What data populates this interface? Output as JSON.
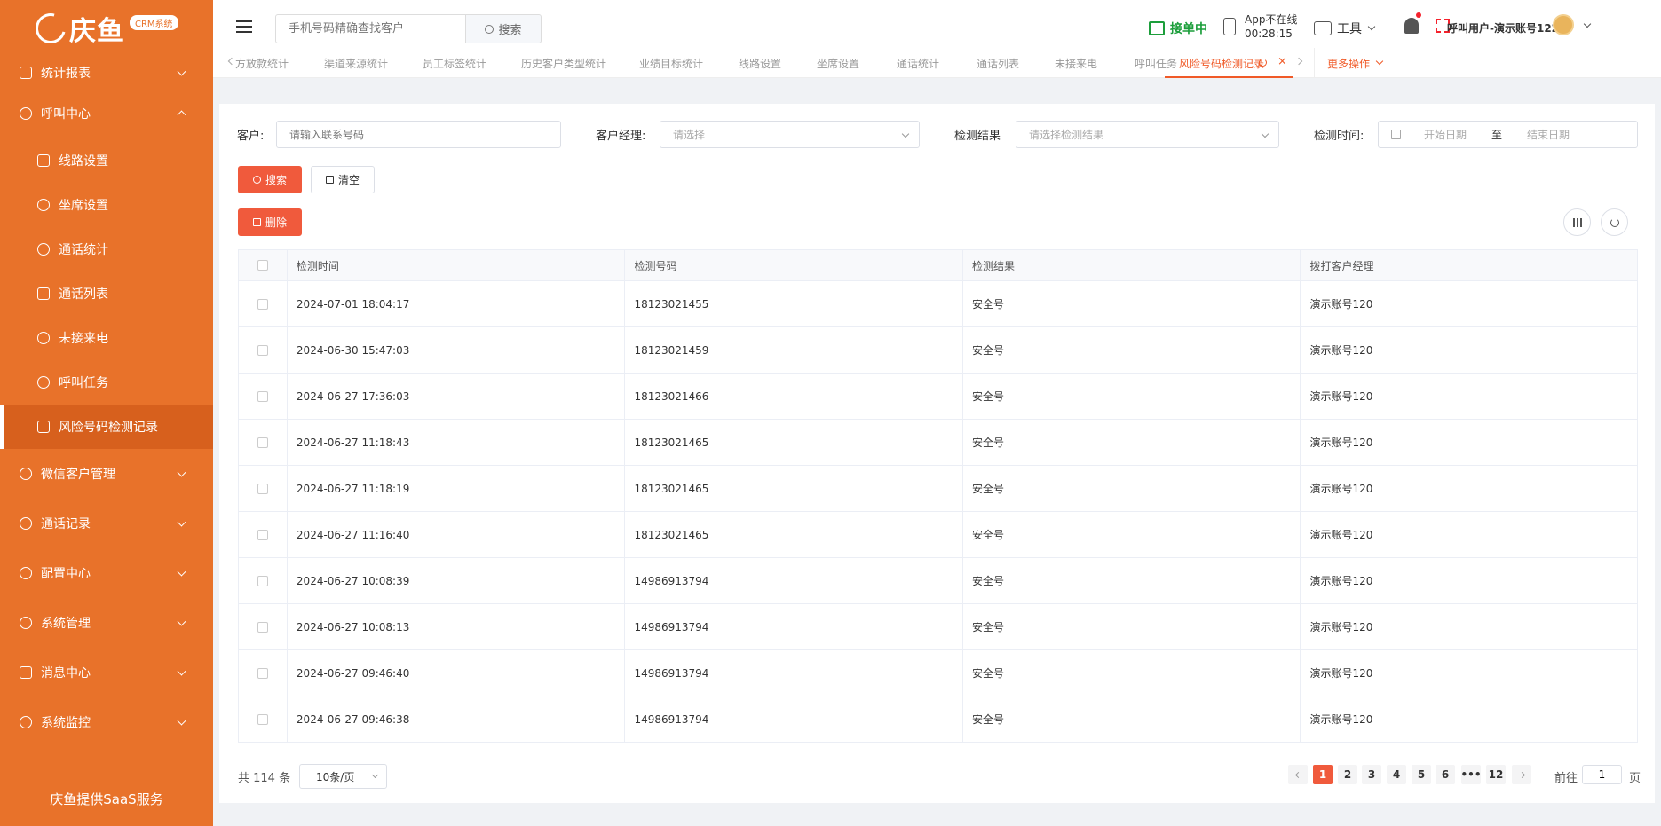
{
  "brand": {
    "name": "庆鱼",
    "badge": "CRM系统"
  },
  "sidebar": {
    "top_item": "统计报表",
    "group_open": "呼叫中心",
    "sub_items": [
      "线路设置",
      "坐席设置",
      "通话统计",
      "通话列表",
      "未接来电",
      "呼叫任务",
      "风险号码检测记录"
    ],
    "groups": [
      "微信客户管理",
      "通话记录",
      "配置中心",
      "系统管理",
      "消息中心",
      "系统监控"
    ],
    "footer": "庆鱼提供SaaS服务"
  },
  "header": {
    "search_placeholder": "手机号码精确查找客户",
    "search_button": "搜索",
    "status": "接单中",
    "app_status": "App不在线",
    "app_timer": "00:28:15",
    "tools": "工具",
    "user": "呼叫用户-演示账号122"
  },
  "tabs": {
    "items": [
      "方放款统计",
      "渠道来源统计",
      "员工标签统计",
      "历史客户类型统计",
      "业绩目标统计",
      "线路设置",
      "坐席设置",
      "通话统计",
      "通话列表",
      "未接来电",
      "呼叫任务",
      "风险号码检测记录"
    ],
    "more": "更多操作"
  },
  "filters": {
    "customer_label": "客户:",
    "customer_placeholder": "请输入联系号码",
    "manager_label": "客户经理:",
    "manager_placeholder": "请选择",
    "result_label": "检测结果",
    "result_placeholder": "请选择检测结果",
    "time_label": "检测时间:",
    "start_placeholder": "开始日期",
    "to": "至",
    "end_placeholder": "结束日期"
  },
  "actions": {
    "search": "搜索",
    "clear": "清空",
    "delete": "删除"
  },
  "table": {
    "headers": [
      "检测时间",
      "检测号码",
      "检测结果",
      "拨打客户经理"
    ],
    "rows": [
      [
        "2024-07-01 18:04:17",
        "18123021455",
        "安全号",
        "演示账号120"
      ],
      [
        "2024-06-30 15:47:03",
        "18123021459",
        "安全号",
        "演示账号120"
      ],
      [
        "2024-06-27 17:36:03",
        "18123021466",
        "安全号",
        "演示账号120"
      ],
      [
        "2024-06-27 11:18:43",
        "18123021465",
        "安全号",
        "演示账号120"
      ],
      [
        "2024-06-27 11:18:19",
        "18123021465",
        "安全号",
        "演示账号120"
      ],
      [
        "2024-06-27 11:16:40",
        "18123021465",
        "安全号",
        "演示账号120"
      ],
      [
        "2024-06-27 10:08:39",
        "14986913794",
        "安全号",
        "演示账号120"
      ],
      [
        "2024-06-27 10:08:13",
        "14986913794",
        "安全号",
        "演示账号120"
      ],
      [
        "2024-06-27 09:46:40",
        "14986913794",
        "安全号",
        "演示账号120"
      ],
      [
        "2024-06-27 09:46:38",
        "14986913794",
        "安全号",
        "演示账号120"
      ]
    ]
  },
  "pagination": {
    "total": "共 114 条",
    "page_size": "10条/页",
    "pages": [
      "1",
      "2",
      "3",
      "4",
      "5",
      "6",
      "•••",
      "12"
    ],
    "current": "1",
    "goto_prefix": "前往",
    "goto_value": "1",
    "goto_suffix": "页"
  },
  "colors": {
    "sidebar": "#e8722a",
    "accent": "#f05a3c",
    "status_green": "#1c9e3b"
  }
}
